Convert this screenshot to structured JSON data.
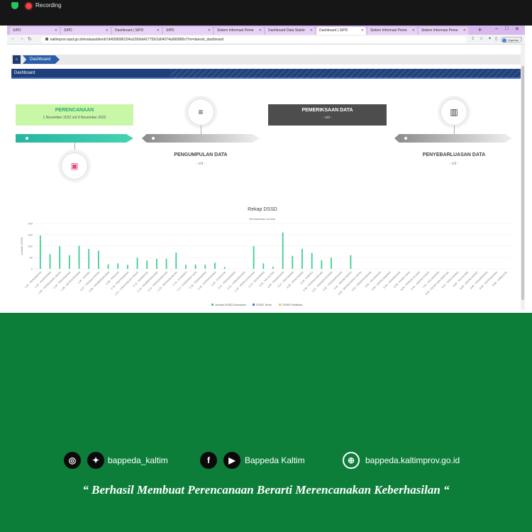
{
  "recording": {
    "label": "Recording"
  },
  "browser": {
    "tabs": [
      {
        "label": "SIPD"
      },
      {
        "label": "SIPD"
      },
      {
        "label": "Dashboard | SIPD"
      },
      {
        "label": "SIPD"
      },
      {
        "label": "Sistem Informasi Peme"
      },
      {
        "label": "Dashboard Data Statist"
      },
      {
        "label": "Dashboard | SIPD"
      },
      {
        "label": "Sistem Informasi Peme"
      },
      {
        "label": "Sistem Informasi Peme"
      }
    ],
    "new_tab_label": "+",
    "url": "kaltimprov.sipd.go.id/evaluasi/dev/b7d4928086224/a1f2b6d427759/1d04074a960880c/?m=daerah_dashboard",
    "profile_label": "Diperbai"
  },
  "breadcrumb": {
    "home_icon": "home-icon",
    "current": "Dashboard"
  },
  "panel": {
    "title": "Dashboard"
  },
  "stages": {
    "perencanaan": {
      "title": "PERENCANAAN",
      "dates": "1 November 2022 s/d 9 November 2022"
    },
    "pengumpulan": {
      "title": "PENGUMPULAN DATA",
      "dates": "- s/d -"
    },
    "pemeriksaan": {
      "title": "PEMERIKSAAN DATA",
      "dates": "- s/d -"
    },
    "penyebarluasan": {
      "title": "PENYEBARLUASAN DATA",
      "dates": "- s/d -"
    }
  },
  "chart_data": {
    "type": "bar",
    "title": "Rekap DSSD",
    "subtitle": "Berdasarkan Urusan",
    "ylabel": "Jumlah DSSD",
    "ylim": [
      0,
      200
    ],
    "yticks": [
      0,
      50,
      100,
      150,
      200
    ],
    "categories": [
      "1.01 - PENDIDIKAN",
      "1.02 - KESEHATAN",
      "1.03 - PEKERJAAN UMUM",
      "1.04 - PERUMAHAN",
      "1.05 - KETENTRAMAN",
      "1.06 - SOSIAL",
      "2.07 - TENAGA KERJA",
      "2.08 - PEMBERDAYAAN",
      "2.09 - PANGAN",
      "2.10 - PERTANAHAN",
      "2.11 - LINGKUNGAN HIDUP",
      "2.12 - ADMINDUK",
      "2.13 - PEMBERDAYAAN",
      "2.14 - PENGENDALIAN",
      "2.15 - PERHUBUNGAN",
      "2.16 - KOMINFO",
      "2.17 - KOPERASI UKM",
      "2.18 - PENANAMAN",
      "2.19 - KEPEMUDAAN",
      "2.20 - STATISTIK",
      "2.21 - PERSANDIAN",
      "2.22 - KEBUDAYAAN",
      "2.23 - PERPUSTAKAAN",
      "2.24 - KEARSIPAN",
      "3.25 - KELAUTAN",
      "3.26 - PARIWISATA",
      "3.27 - PERTANIAN",
      "3.28 - KEHUTANAN",
      "3.29 - ENERGI",
      "3.30 - PERDAGANGAN",
      "3.31 - PERINDUSTRIAN",
      "3.32 - TRANSMIGRASI",
      "4.01 - SEKRETARIAT",
      "4.02 - SEKRETARIAT DPRD",
      "5.01 - PERENCANAAN",
      "5.02 - KEUANGAN",
      "5.03 - KEPEGAWAIAN",
      "5.04 - PENDIDIKAN",
      "5.05 - PENELITIAN",
      "5.06 - PENGELOLAAN",
      "6.01 - INSPEKTORAT",
      "7.01 - KECAMATAN",
      "8.01 - KESATUAN BANGSA",
      "9.01 - KEHUTANAN",
      "9.02 - KELAUTAN",
      "9.03 - SEKRETARIAT",
      "9.04 - PENDAPATAN",
      "9.05 - PERTANAHAN",
      "9.06 - KAB/KOTA"
    ],
    "series": [
      {
        "name": "Jumlah DSSD Diusulkan",
        "color": "#3ecf8e",
        "values": [
          147,
          65,
          100,
          60,
          102,
          88,
          80,
          20,
          24,
          18,
          49,
          36,
          44,
          44,
          72,
          18,
          19,
          18,
          27,
          8,
          0,
          0,
          100,
          24,
          9,
          160,
          57,
          88,
          70,
          38,
          49,
          0,
          60,
          0,
          0,
          0,
          0,
          0,
          0,
          0,
          0,
          0,
          0,
          0,
          0,
          0,
          0,
          0,
          0
        ]
      },
      {
        "name": "DSSD Terisi",
        "color": "#4a6ed0",
        "values": []
      },
      {
        "name": "DSSD Publikasi",
        "color": "#f3b56b",
        "values": []
      }
    ]
  },
  "social": {
    "instagram_icon": "instagram-icon",
    "twitter_icon": "twitter-icon",
    "handle1": "bappeda_kaltim",
    "facebook_icon": "facebook-icon",
    "youtube_icon": "youtube-icon",
    "handle2": "Bappeda Kaltim",
    "globe_icon": "globe-icon",
    "website": "bappeda.kaltimprov.go.id"
  },
  "quote": "“ Berhasil  Membuat Perencanaan Berarti Merencanakan Keberhasilan “"
}
